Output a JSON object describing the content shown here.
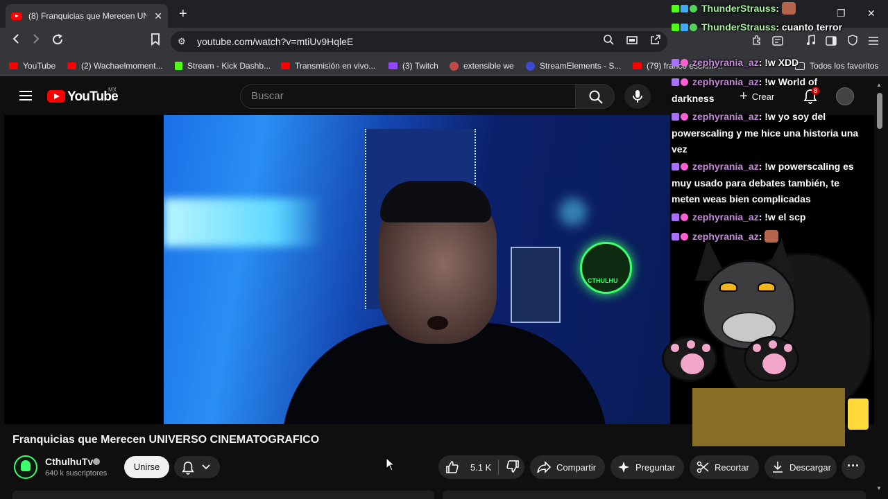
{
  "browser": {
    "tab_title": "(8) Franquicias que Merecen UNIVE",
    "url": "youtube.com/watch?v=mtiUv9HqleE",
    "bookmarks": [
      {
        "label": "YouTube",
        "icon": "youtube-icon"
      },
      {
        "label": "(2) Wachaelmoment...",
        "icon": "youtube-icon"
      },
      {
        "label": "Stream - Kick Dashb...",
        "icon": "kick-icon"
      },
      {
        "label": "Transmisión en vivo...",
        "icon": "youtube-icon"
      },
      {
        "label": "(3) Twitch",
        "icon": "twitch-icon"
      },
      {
        "label": "extensible we",
        "icon": "extension-icon"
      },
      {
        "label": "StreamElements - S...",
        "icon": "streamelements-icon"
      },
      {
        "label": "(79) franco escami...",
        "icon": "youtube-icon"
      },
      {
        "label": "Todos los favoritos",
        "icon": "folder-icon"
      }
    ]
  },
  "youtube": {
    "logo_text": "YouTube",
    "region": "MX",
    "search_placeholder": "Buscar",
    "create_label": "Crear",
    "notification_count": "8",
    "video_title": "Franquicias que Merecen UNIVERSO CINEMATOGRAFICO",
    "channel_name": "CthulhuTv",
    "subscribers": "640 k suscriptores",
    "join_label": "Unirse",
    "likes": "5.1 K",
    "share_label": "Compartir",
    "ask_label": "Preguntar",
    "clip_label": "Recortar",
    "download_label": "Descargar",
    "neon_sign_text": "CTHULHU"
  },
  "chat": {
    "messages": [
      {
        "user": "ThunderStrauss",
        "text": ": ",
        "emote": true
      },
      {
        "user": "ThunderStrauss",
        "text": ": cuanto terror"
      },
      {
        "user": "zephyrania_az",
        "text": ": !w XDD"
      },
      {
        "user": "zephyrania_az",
        "text": ": !w World of darkness"
      },
      {
        "user": "zephyrania_az",
        "text": ": !w yo soy del powerscaling y me hice una historia una vez"
      },
      {
        "user": "zephyrania_az",
        "text": ": !w powerscaling es muy usado para debates también, te meten weas bien complicadas"
      },
      {
        "user": "zephyrania_az",
        "text": ": !w el scp"
      },
      {
        "user": "zephyrania_az",
        "text": ": ",
        "emote": true
      }
    ]
  },
  "colors": {
    "youtube_red": "#ff0000",
    "thunder_name": "#a7f0a0",
    "zephyr_name": "#c58bd8",
    "kick_green": "#53fc18"
  }
}
